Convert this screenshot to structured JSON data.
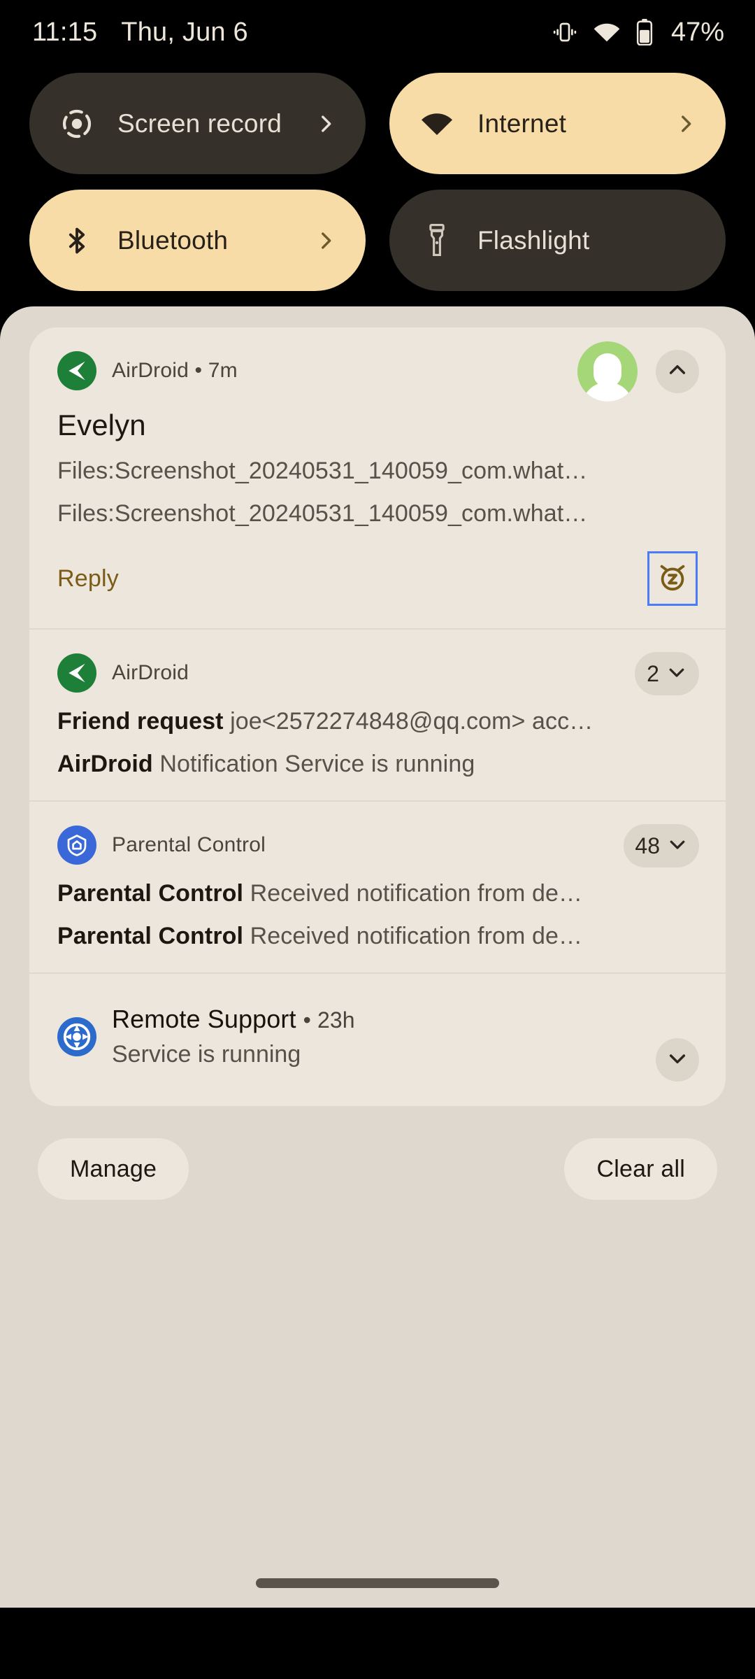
{
  "status_bar": {
    "time": "11:15",
    "date": "Thu, Jun 6",
    "battery_percent": "47%",
    "icons": [
      "vibrate-icon",
      "wifi-icon",
      "battery-icon"
    ]
  },
  "quick_settings": {
    "tiles": [
      {
        "label": "Screen record",
        "icon": "screen-record-icon",
        "state": "inactive",
        "has_chevron": true
      },
      {
        "label": "Internet",
        "icon": "wifi-icon",
        "state": "active",
        "has_chevron": true
      },
      {
        "label": "Bluetooth",
        "icon": "bluetooth-icon",
        "state": "active",
        "has_chevron": true
      },
      {
        "label": "Flashlight",
        "icon": "flashlight-icon",
        "state": "inactive",
        "has_chevron": false
      }
    ]
  },
  "notifications": [
    {
      "app": "AirDroid",
      "header": "AirDroid • 7m",
      "time": "7m",
      "title": "Evelyn",
      "line1": "Files:Screenshot_20240531_140059_com.what…",
      "line2": "Files:Screenshot_20240531_140059_com.what…",
      "reply_label": "Reply",
      "snooze_icon": "snooze-alarm-icon",
      "expand_icon": "chevron-up-icon",
      "avatar": "contact-avatar"
    },
    {
      "app": "AirDroid",
      "count": "2",
      "expand_icon": "chevron-down-icon",
      "rows": [
        {
          "bold": "Friend request",
          "rest": " joe<2572274848@qq.com> acc…"
        },
        {
          "bold": "AirDroid",
          "rest": " Notification Service is running"
        }
      ]
    },
    {
      "app": "Parental Control",
      "count": "48",
      "expand_icon": "chevron-down-icon",
      "rows": [
        {
          "bold": "Parental Control",
          "rest": " Received notification from de…"
        },
        {
          "bold": "Parental Control",
          "rest": " Received notification from de…"
        }
      ]
    },
    {
      "app": "Remote Support",
      "header": "Remote Support",
      "time": "23h",
      "subtitle": "Service is running",
      "expand_icon": "chevron-down-icon"
    }
  ],
  "shade_actions": {
    "manage_label": "Manage",
    "clear_all_label": "Clear all"
  },
  "colors": {
    "shade_bg": "#DFD8CE",
    "notif_bg": "#EDE6DD",
    "tile_active": "#F7DCA7",
    "tile_inactive": "#35302A",
    "accent_reply": "#7A5C16",
    "focus_outline": "#4A7CF7",
    "airdroid_green": "#1E8038",
    "parental_blue": "#3B68D8",
    "remote_blue": "#2C6ACB"
  }
}
